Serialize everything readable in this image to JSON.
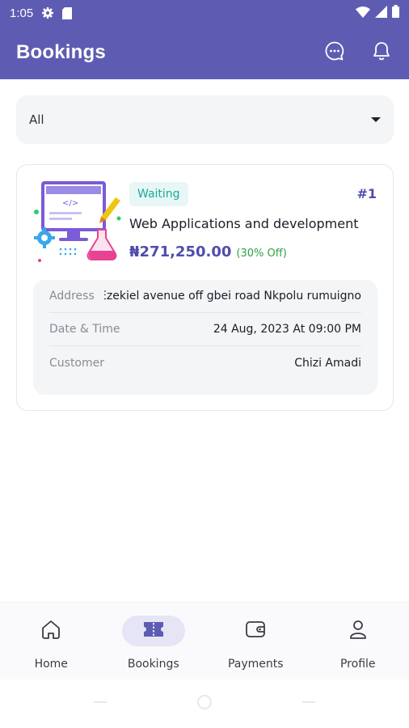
{
  "status_bar": {
    "time": "1:05"
  },
  "app_bar": {
    "title": "Bookings"
  },
  "filter": {
    "value": "All"
  },
  "booking": {
    "status": "Waiting",
    "id": "#1",
    "service": "Web Applications and development",
    "price": "₦271,250.00",
    "discount": "(30% Off)",
    "details": [
      {
        "label": "Address",
        "value": "Rumuigbo, Ezekiel avenue off gbei road Nkpolu rumuigno"
      },
      {
        "label": "Date & Time",
        "value": "24 Aug, 2023 At 09:00 PM"
      },
      {
        "label": "Customer",
        "value": "Chizi Amadi"
      }
    ]
  },
  "bottom_nav": {
    "items": [
      {
        "label": "Home",
        "icon": "home-icon",
        "active": false
      },
      {
        "label": "Bookings",
        "icon": "ticket-icon",
        "active": true
      },
      {
        "label": "Payments",
        "icon": "wallet-icon",
        "active": false
      },
      {
        "label": "Profile",
        "icon": "person-icon",
        "active": false
      }
    ]
  },
  "colors": {
    "primary": "#5e5cb2",
    "accent_text": "#4f4dab",
    "badge_bg": "#e8f7f5",
    "badge_text": "#1aa99a",
    "discount": "#2ea043"
  }
}
